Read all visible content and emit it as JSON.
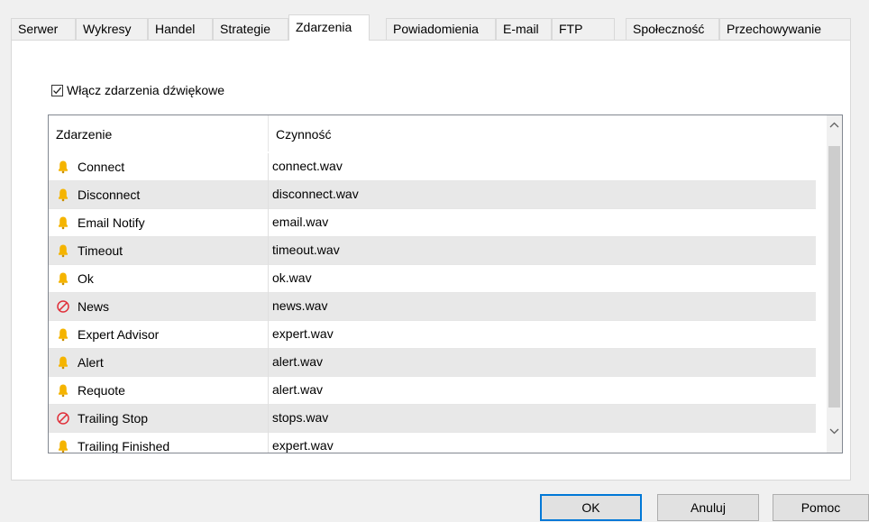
{
  "tabs": [
    {
      "label": "Serwer",
      "active": false
    },
    {
      "label": "Wykresy",
      "active": false
    },
    {
      "label": "Handel",
      "active": false
    },
    {
      "label": "Strategie",
      "active": false
    },
    {
      "label": "Zdarzenia",
      "active": true
    },
    {
      "label": "Powiadomienia",
      "active": false
    },
    {
      "label": "E-mail",
      "active": false
    },
    {
      "label": "FTP",
      "active": false
    },
    {
      "label": "Społeczność",
      "active": false
    },
    {
      "label": "Przechowywanie",
      "active": false
    }
  ],
  "sound_events": {
    "checkbox_label": "Włącz zdarzenia dźwiękowe",
    "checked": true
  },
  "table": {
    "columns": [
      "Zdarzenie",
      "Czynność"
    ],
    "rows": [
      {
        "event": "Connect",
        "action": "connect.wav",
        "icon": "bell-icon"
      },
      {
        "event": "Disconnect",
        "action": "disconnect.wav",
        "icon": "bell-icon"
      },
      {
        "event": "Email Notify",
        "action": "email.wav",
        "icon": "bell-icon"
      },
      {
        "event": "Timeout",
        "action": "timeout.wav",
        "icon": "bell-icon"
      },
      {
        "event": "Ok",
        "action": "ok.wav",
        "icon": "bell-icon"
      },
      {
        "event": "News",
        "action": "news.wav",
        "icon": "disabled-icon"
      },
      {
        "event": "Expert Advisor",
        "action": "expert.wav",
        "icon": "bell-icon"
      },
      {
        "event": "Alert",
        "action": "alert.wav",
        "icon": "bell-icon"
      },
      {
        "event": "Requote",
        "action": "alert.wav",
        "icon": "bell-icon"
      },
      {
        "event": "Trailing Stop",
        "action": "stops.wav",
        "icon": "disabled-icon"
      },
      {
        "event": "Trailing Finished",
        "action": "expert.wav",
        "icon": "bell-icon"
      }
    ]
  },
  "colors": {
    "bell": "#f5b400",
    "disabled": "#e0303a",
    "default_button_border": "#0078d7"
  },
  "buttons": {
    "ok": "OK",
    "cancel": "Anuluj",
    "help": "Pomoc"
  }
}
